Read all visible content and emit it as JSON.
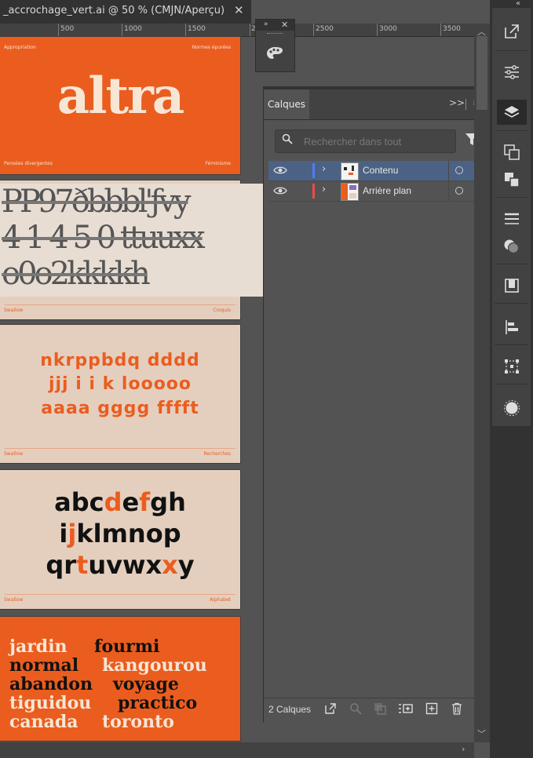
{
  "document_tab": {
    "title": "_accrochage_vert.ai @ 50 % (CMJN/Aperçu)",
    "close": "✕"
  },
  "ruler": {
    "labels": [
      "500",
      "1000",
      "1500",
      "2",
      "2500",
      "3000",
      "3500"
    ]
  },
  "artboards": {
    "board1": {
      "top_left": "Appropriation",
      "top_right": "Normes épurées",
      "headline": "altra",
      "bottom_left": "Pensées divergentes",
      "bottom_right": "Féminisme"
    },
    "board2": {
      "rows": [
        "PP9‍7ðbbbl'ƒvy",
        "4 1 4 5 0 ttuuxx",
        "o0o2kkkkh"
      ],
      "footer_left": "Swallow",
      "footer_right": "Croquis"
    },
    "board3": {
      "rows": [
        "nkrppbdq dddd",
        "jjj i i k looooo",
        "aaaa gggg fffft"
      ],
      "footer_left": "Swallow",
      "footer_right": "Recherches"
    },
    "board4": {
      "rows": [
        {
          "before": "abc",
          "hl1": "d",
          "mid": "e",
          "hl2": "f",
          "after": "gh"
        },
        {
          "before": "i",
          "hl1": "j",
          "mid": "klmnop",
          "hl2": "",
          "after": ""
        },
        {
          "before": "qr",
          "hl1": "t",
          "mid": "uvwx",
          "hl2": "x",
          "after": "y"
        }
      ],
      "footer_left": "Swallow",
      "footer_right": "Alphabet"
    },
    "board5": {
      "words": [
        {
          "text": "jardin",
          "tone": "w"
        },
        {
          "text": "fourmi",
          "tone": "k"
        },
        {
          "text": "normal",
          "tone": "k"
        },
        {
          "text": "kangourou",
          "tone": "w"
        },
        {
          "text": "abandon",
          "tone": "k"
        },
        {
          "text": "voyage",
          "tone": "k"
        },
        {
          "text": "tiguidou",
          "tone": "w"
        },
        {
          "text": "practico",
          "tone": "k"
        },
        {
          "text": "canada",
          "tone": "w"
        },
        {
          "text": "toronto",
          "tone": "w"
        }
      ]
    }
  },
  "mini_panel": {
    "expand": "»",
    "close": "✕",
    "icon": "palette-icon"
  },
  "layers_panel": {
    "tab": "Calques",
    "collapse": ">>",
    "search_placeholder": "Rechercher dans tout",
    "layers": [
      {
        "name": "Contenu",
        "color": "#4f7cf5",
        "selected": true
      },
      {
        "name": "Arrière plan",
        "color": "#e64d4d",
        "selected": false
      }
    ],
    "count": "2 Calques"
  },
  "colors": {
    "accent_orange": "#ea5d1f",
    "cream": "#e4cfbf",
    "selection": "#4b6284"
  }
}
